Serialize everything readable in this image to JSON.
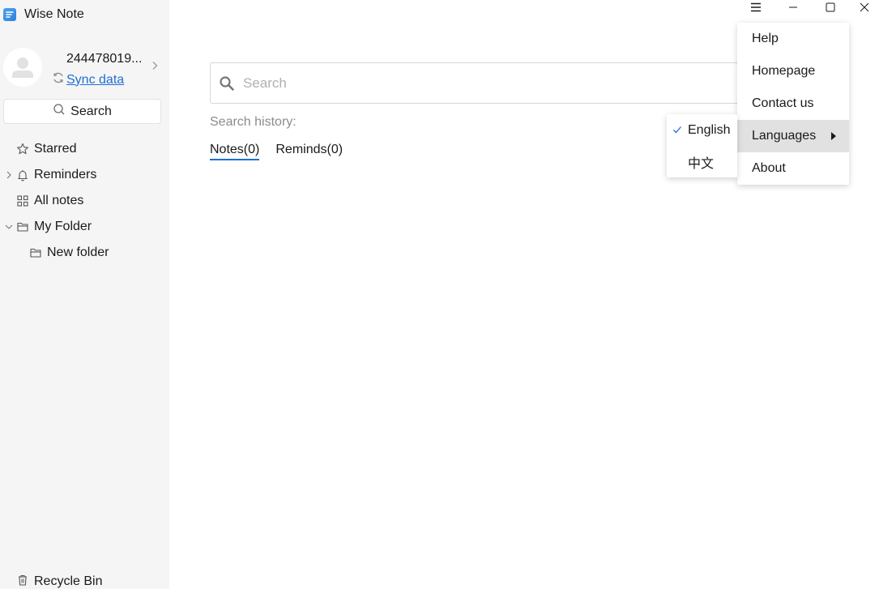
{
  "app": {
    "title": "Wise Note"
  },
  "user": {
    "name": "244478019...",
    "sync_label": "Sync data"
  },
  "sidebar": {
    "search_label": "Search",
    "items": [
      {
        "label": "Starred"
      },
      {
        "label": "Reminders"
      },
      {
        "label": "All notes"
      },
      {
        "label": "My Folder"
      },
      {
        "label": "New folder"
      }
    ],
    "recycle_label": "Recycle Bin"
  },
  "main": {
    "search_placeholder": "Search",
    "history_label": "Search history:",
    "tabs": [
      {
        "label": "Notes(0)",
        "active": true
      },
      {
        "label": "Reminds(0)",
        "active": false
      }
    ]
  },
  "menu": {
    "items": [
      {
        "label": "Help"
      },
      {
        "label": "Homepage"
      },
      {
        "label": "Contact us"
      },
      {
        "label": "Languages"
      },
      {
        "label": "About"
      }
    ]
  },
  "languages": {
    "items": [
      {
        "label": "English",
        "checked": true
      },
      {
        "label": "中文",
        "checked": false
      }
    ]
  },
  "colors": {
    "accent": "#1d6fd6",
    "sidebar_bg": "#f5f5f5",
    "hover_bg": "#e1e1e1"
  }
}
